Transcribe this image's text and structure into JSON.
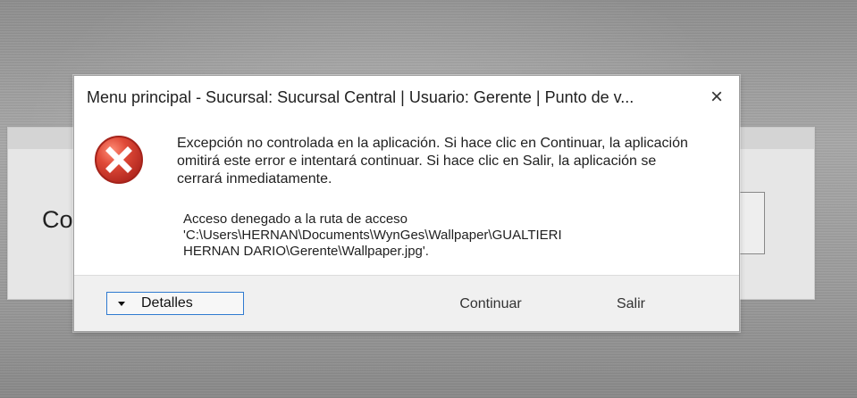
{
  "dialog": {
    "title": "Menu principal - Sucursal: Sucursal Central | Usuario: Gerente | Punto de v...",
    "message": "Excepción no controlada en la aplicación. Si hace clic en Continuar, la aplicación omitirá este error e intentará continuar. Si hace clic en Salir, la aplicación se cerrará inmediatamente.",
    "detail_lines": [
      "Acceso denegado a la ruta de acceso",
      "'C:\\Users\\HERNAN\\Documents\\WynGes\\Wallpaper\\GUALTIERI",
      "HERNAN DARIO\\Gerente\\Wallpaper.jpg'."
    ],
    "buttons": {
      "details": "Detalles",
      "continue": "Continuar",
      "exit": "Salir"
    },
    "close_icon": "×"
  },
  "background_window": {
    "field_label": "Coc"
  },
  "icons": {
    "error": "error-icon",
    "close": "close-icon",
    "chevron_down": "chevron-down-icon"
  },
  "colors": {
    "accent": "#2f7ad0",
    "error_red": "#d63a2f"
  }
}
